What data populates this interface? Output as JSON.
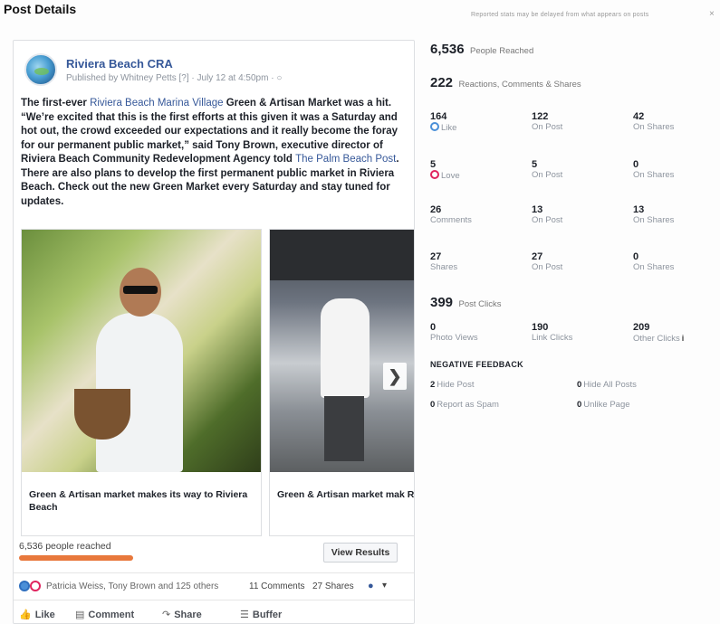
{
  "page": {
    "title": "Post Details",
    "disclaimer": "Reported stats may be delayed from what appears on posts",
    "close_glyph": "×"
  },
  "post": {
    "page_name": "Riviera Beach CRA",
    "byline": "Published by Whitney Petts [?] · July 12 at 4:50pm · ○",
    "text_parts": [
      "The first-ever ",
      "Riviera Beach Marina Village",
      " Green & Artisan Market was a hit. “We’re excited that this is the first efforts at this given it was a Saturday and hot out, the crowd exceeded our expectations and it really become the foray for our permanent public market,” said Tony Brown, executive director of Riviera Beach Community Redevelopment Agency told ",
      "The Palm Beach Post",
      ". There are also plans to develop the first permanent public market in Riviera Beach. Check out the new Green Market every Saturday and stay tuned for updates."
    ],
    "carousel": [
      {
        "caption": "Green & Artisan market makes its way to Riviera Beach"
      },
      {
        "caption": "Green & Artisan market mak Riviera Beach"
      }
    ],
    "next_arrow": "❯",
    "reach_summary": "6,536 people reached",
    "reach_fraction": 0.3,
    "view_results_label": "View Results",
    "reaction_names": "Patricia Weiss, Tony Brown and 125 others",
    "comments_count": "11 Comments",
    "shares_count": "27 Shares",
    "globe_icon": "●",
    "caret_icon": "▾",
    "actions": [
      {
        "icon": "👍",
        "label": "Like"
      },
      {
        "icon": "▤",
        "label": "Comment"
      },
      {
        "icon": "↷",
        "label": "Share"
      },
      {
        "icon": "☰",
        "label": "Buffer"
      }
    ]
  },
  "stats": {
    "reach": {
      "value": "6,536",
      "label": "People Reached"
    },
    "engagement": {
      "value": "222",
      "label": "Reactions, Comments & Shares"
    },
    "rows": [
      [
        {
          "value": "164",
          "label": "Like",
          "icon": "like"
        },
        {
          "value": "122",
          "label": "On Post"
        },
        {
          "value": "42",
          "label": "On Shares"
        }
      ],
      [
        {
          "value": "5",
          "label": "Love",
          "icon": "love"
        },
        {
          "value": "5",
          "label": "On Post"
        },
        {
          "value": "0",
          "label": "On Shares"
        }
      ],
      [
        {
          "value": "26",
          "label": "Comments"
        },
        {
          "value": "13",
          "label": "On Post"
        },
        {
          "value": "13",
          "label": "On Shares"
        }
      ],
      [
        {
          "value": "27",
          "label": "Shares"
        },
        {
          "value": "27",
          "label": "On Post"
        },
        {
          "value": "0",
          "label": "On Shares"
        }
      ]
    ],
    "clicks": {
      "value": "399",
      "label": "Post Clicks"
    },
    "click_rows": [
      {
        "value": "0",
        "label": "Photo Views"
      },
      {
        "value": "190",
        "label": "Link Clicks"
      },
      {
        "value": "209",
        "label": "Other Clicks",
        "info": "i"
      }
    ],
    "negative_title": "NEGATIVE FEEDBACK",
    "negative": [
      {
        "value": "2",
        "label": "Hide Post"
      },
      {
        "value": "0",
        "label": "Hide All Posts"
      },
      {
        "value": "0",
        "label": "Report as Spam"
      },
      {
        "value": "0",
        "label": "Unlike Page"
      }
    ]
  },
  "colors": {
    "link": "#365899",
    "reach_bar": "#e8783c",
    "like": "#4a8fd8",
    "love": "#e0245e"
  }
}
